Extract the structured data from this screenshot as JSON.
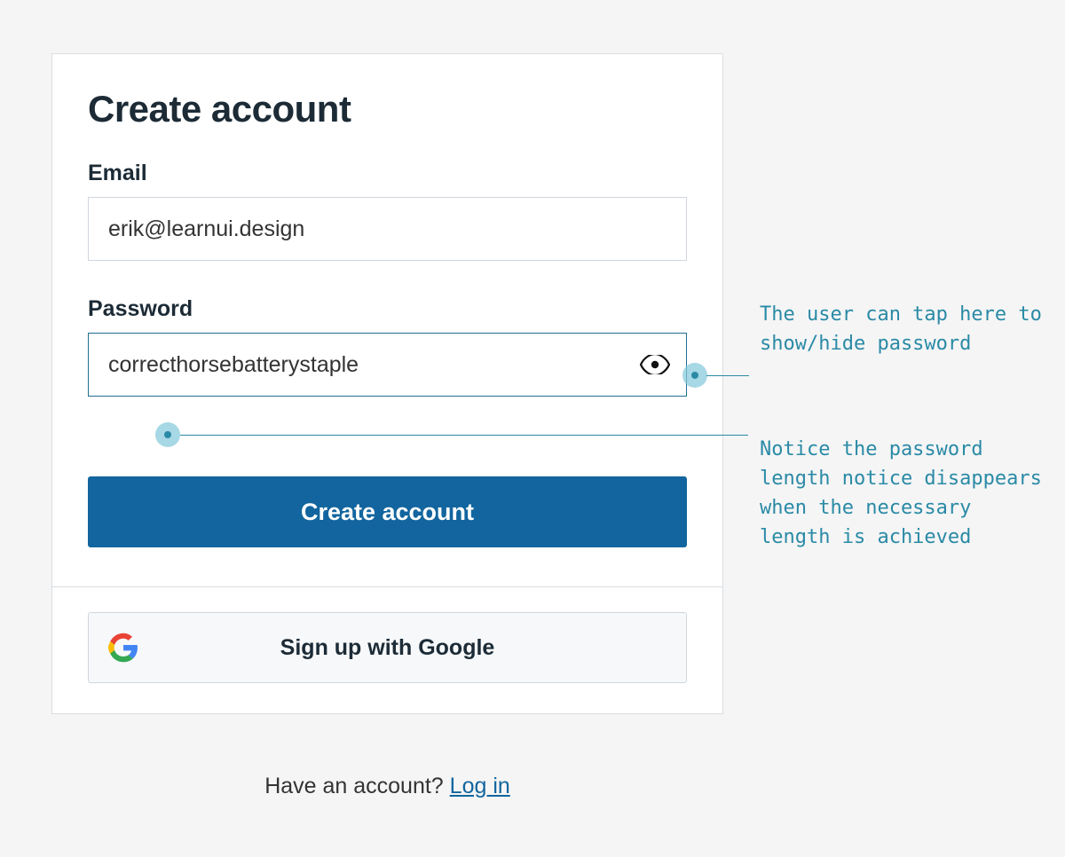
{
  "form": {
    "title": "Create account",
    "email": {
      "label": "Email",
      "value": "erik@learnui.design"
    },
    "password": {
      "label": "Password",
      "value": "correcthorsebatterystaple"
    },
    "submit_label": "Create account",
    "google_label": "Sign up with Google"
  },
  "footer": {
    "prompt": "Have an account? ",
    "link_text": "Log in"
  },
  "annotations": {
    "show_hide": "The user can tap here to show/hide password",
    "length_notice": "Notice the password length notice disappears when the necessary length is achieved"
  }
}
